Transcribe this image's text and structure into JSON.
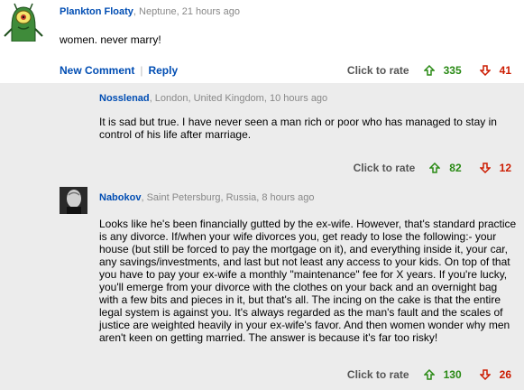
{
  "comments": [
    {
      "author": "Plankton Floaty",
      "location_time": ", Neptune, 21 hours ago",
      "text": "women. never marry!",
      "actions": {
        "new_comment": "New Comment",
        "reply": "Reply"
      },
      "rate_label": "Click to rate",
      "up": "335",
      "down": "41"
    },
    {
      "author": "Nosslenad",
      "location_time": ", London, United Kingdom, 10 hours ago",
      "text": "It is sad but true. I have never seen a man rich or poor who has managed to stay in control of his life after marriage.",
      "rate_label": "Click to rate",
      "up": "82",
      "down": "12"
    },
    {
      "author": "Nabokov",
      "location_time": ", Saint Petersburg, Russia, 8 hours ago",
      "text": "Looks like he's been financially gutted by the ex-wife. However, that's standard practice is any divorce. If/when your wife divorces you, get ready to lose the following:- your house (but still be forced to pay the mortgage on it), and everything inside it, your car, any savings/investments, and last but not least any access to your kids. On top of that you have to pay your ex-wife a monthly \"maintenance\" fee for X years. If you're lucky, you'll emerge from your divorce with the clothes on your back and an overnight bag with a few bits and pieces in it, but that's all. The incing on the cake is that the entire legal system is against you. It's always regarded as the man's fault and the scales of justice are weighted heavily in your ex-wife's favor. And then women wonder why men aren't keen on getting married. The answer is because it's far too risky!",
      "rate_label": "Click to rate",
      "up": "130",
      "down": "26"
    }
  ],
  "colors": {
    "author": "#004db3",
    "meta": "#888888",
    "up": "#2a8a15",
    "down": "#cc1b00"
  }
}
